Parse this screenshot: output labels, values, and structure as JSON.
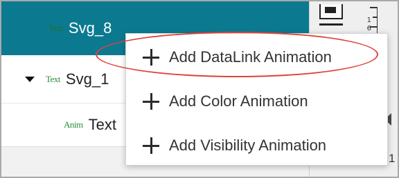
{
  "tree": {
    "rows": [
      {
        "type_badge": "Text",
        "name": "Svg_8"
      },
      {
        "type_badge": "Text",
        "name": "Svg_1"
      },
      {
        "type_badge": "Anim",
        "name": "Text"
      }
    ]
  },
  "context_menu": {
    "items": [
      {
        "label": "Add DataLink Animation",
        "icon": "plus-icon"
      },
      {
        "label": "Add Color Animation",
        "icon": "plus-icon"
      },
      {
        "label": "Add Visibility Animation",
        "icon": "plus-icon"
      }
    ]
  },
  "side_panel": {
    "ruler_labels": [
      "1",
      "6"
    ],
    "edge_label": "1"
  },
  "colors": {
    "selected_row": "#0b7a91",
    "type_badge": "#2e8b3a",
    "highlight": "#e0413a"
  }
}
